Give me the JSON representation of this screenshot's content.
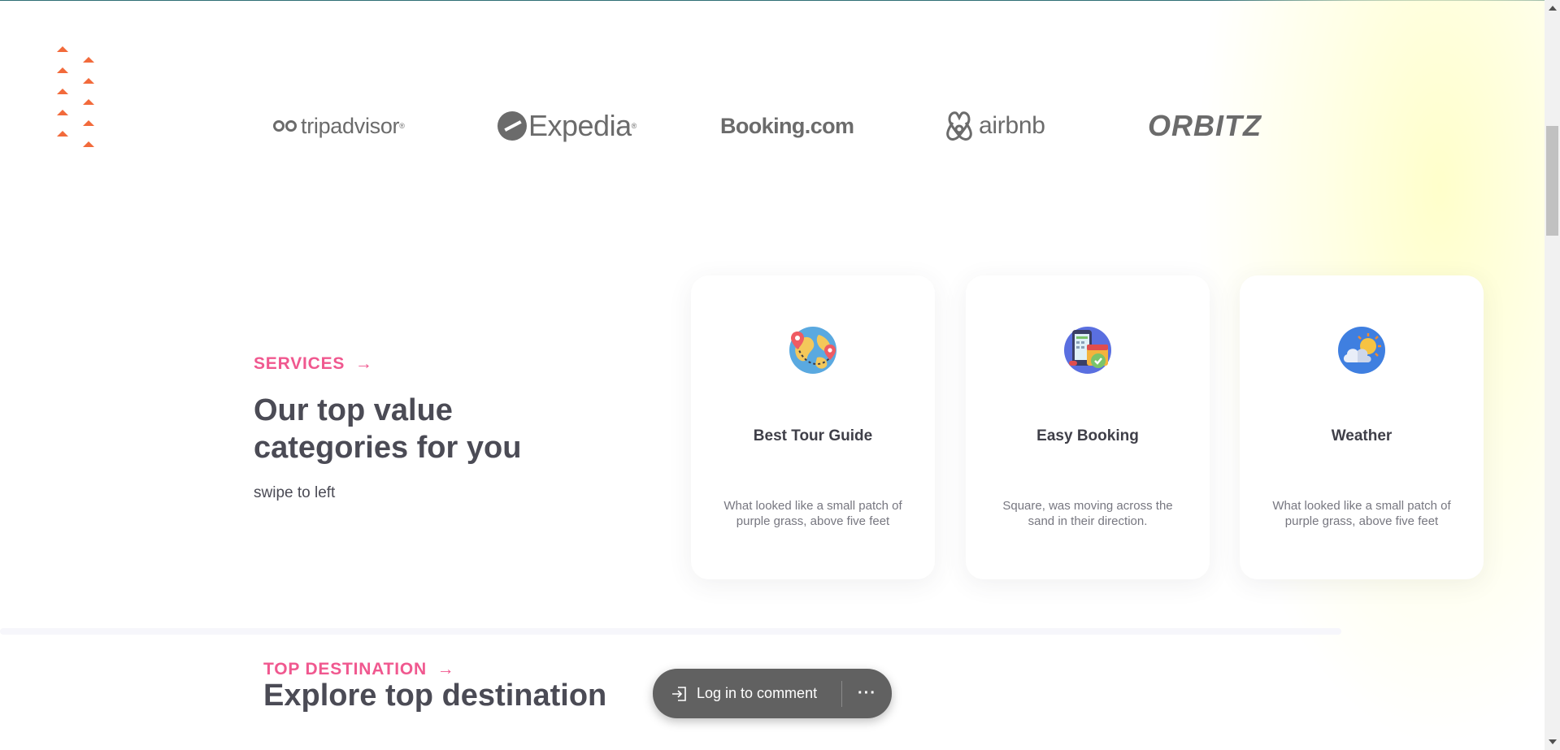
{
  "partners": {
    "logos": [
      {
        "name": "tripadvisor",
        "text": "tripadvisor",
        "mark": "®"
      },
      {
        "name": "expedia",
        "text": "Expedia",
        "mark": "®"
      },
      {
        "name": "booking",
        "text": "Booking.com"
      },
      {
        "name": "airbnb",
        "text": "airbnb"
      },
      {
        "name": "orbitz",
        "text": "ORBITZ"
      }
    ]
  },
  "services": {
    "label": "SERVICES",
    "arrow": "→",
    "title": "Our top value categories for you",
    "hint": "swipe to left",
    "cards": [
      {
        "title": "Best Tour Guide",
        "text": "What looked like a small patch of purple grass, above five feet",
        "icon": "globe-map-pins-icon"
      },
      {
        "title": "Easy Booking",
        "text": "Square, was moving across the sand in their direction.",
        "icon": "booking-calendar-icon"
      },
      {
        "title": "Weather",
        "text": "What looked like a small patch of purple grass, above five feet",
        "icon": "cloud-sun-icon"
      }
    ]
  },
  "destination": {
    "label": "TOP DESTINATION",
    "arrow": "→",
    "title": "Explore top destination"
  },
  "comment_bar": {
    "login_label": "Log in to comment",
    "more_label": "···"
  },
  "colors": {
    "accent_pink": "#f0588f",
    "deco_orange": "#f26a3b",
    "logo_gray": "#6b6b6b",
    "heading": "#4b4b55"
  }
}
